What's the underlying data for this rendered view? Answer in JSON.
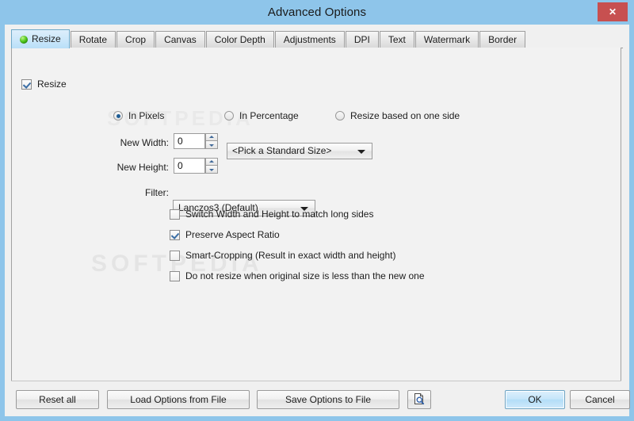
{
  "window": {
    "title": "Advanced Options",
    "close_label": "✕",
    "titlebar_color": "#8ec5ea",
    "close_button_color": "#c75050"
  },
  "watermark": {
    "text": "SOFTPEDIA",
    "text2": "SOFTPEDIA"
  },
  "tabs": [
    {
      "label": "Resize",
      "active": true,
      "has_indicator": true,
      "indicator_color": "#46bb17"
    },
    {
      "label": "Rotate",
      "active": false,
      "has_indicator": false
    },
    {
      "label": "Crop",
      "active": false,
      "has_indicator": false
    },
    {
      "label": "Canvas",
      "active": false,
      "has_indicator": false
    },
    {
      "label": "Color Depth",
      "active": false,
      "has_indicator": false
    },
    {
      "label": "Adjustments",
      "active": false,
      "has_indicator": false
    },
    {
      "label": "DPI",
      "active": false,
      "has_indicator": false
    },
    {
      "label": "Text",
      "active": false,
      "has_indicator": false
    },
    {
      "label": "Watermark",
      "active": false,
      "has_indicator": false
    },
    {
      "label": "Border",
      "active": false,
      "has_indicator": false
    }
  ],
  "resize_panel": {
    "enable_checkbox": {
      "label": "Resize",
      "checked": true
    },
    "mode_radios": [
      {
        "label": "In Pixels",
        "selected": true
      },
      {
        "label": "In Percentage",
        "selected": false
      },
      {
        "label": "Resize based on one side",
        "selected": false
      }
    ],
    "new_width": {
      "label": "New Width:",
      "value": "0"
    },
    "new_height": {
      "label": "New Height:",
      "value": "0"
    },
    "standard_size": {
      "value": "<Pick a Standard Size>"
    },
    "filter": {
      "label": "Filter:",
      "value": "Lanczos3 (Default)"
    },
    "options": [
      {
        "label": "Switch Width and Height to match long sides",
        "checked": false
      },
      {
        "label": "Preserve Aspect Ratio",
        "checked": true
      },
      {
        "label": "Smart-Cropping (Result in exact width and height)",
        "checked": false
      },
      {
        "label": "Do not resize when original size is less than the new one",
        "checked": false
      }
    ]
  },
  "footer": {
    "reset_all": "Reset all",
    "load_options": "Load Options from File",
    "save_options": "Save Options to File",
    "preview_icon": "preview-document-icon",
    "ok": "OK",
    "cancel": "Cancel"
  }
}
